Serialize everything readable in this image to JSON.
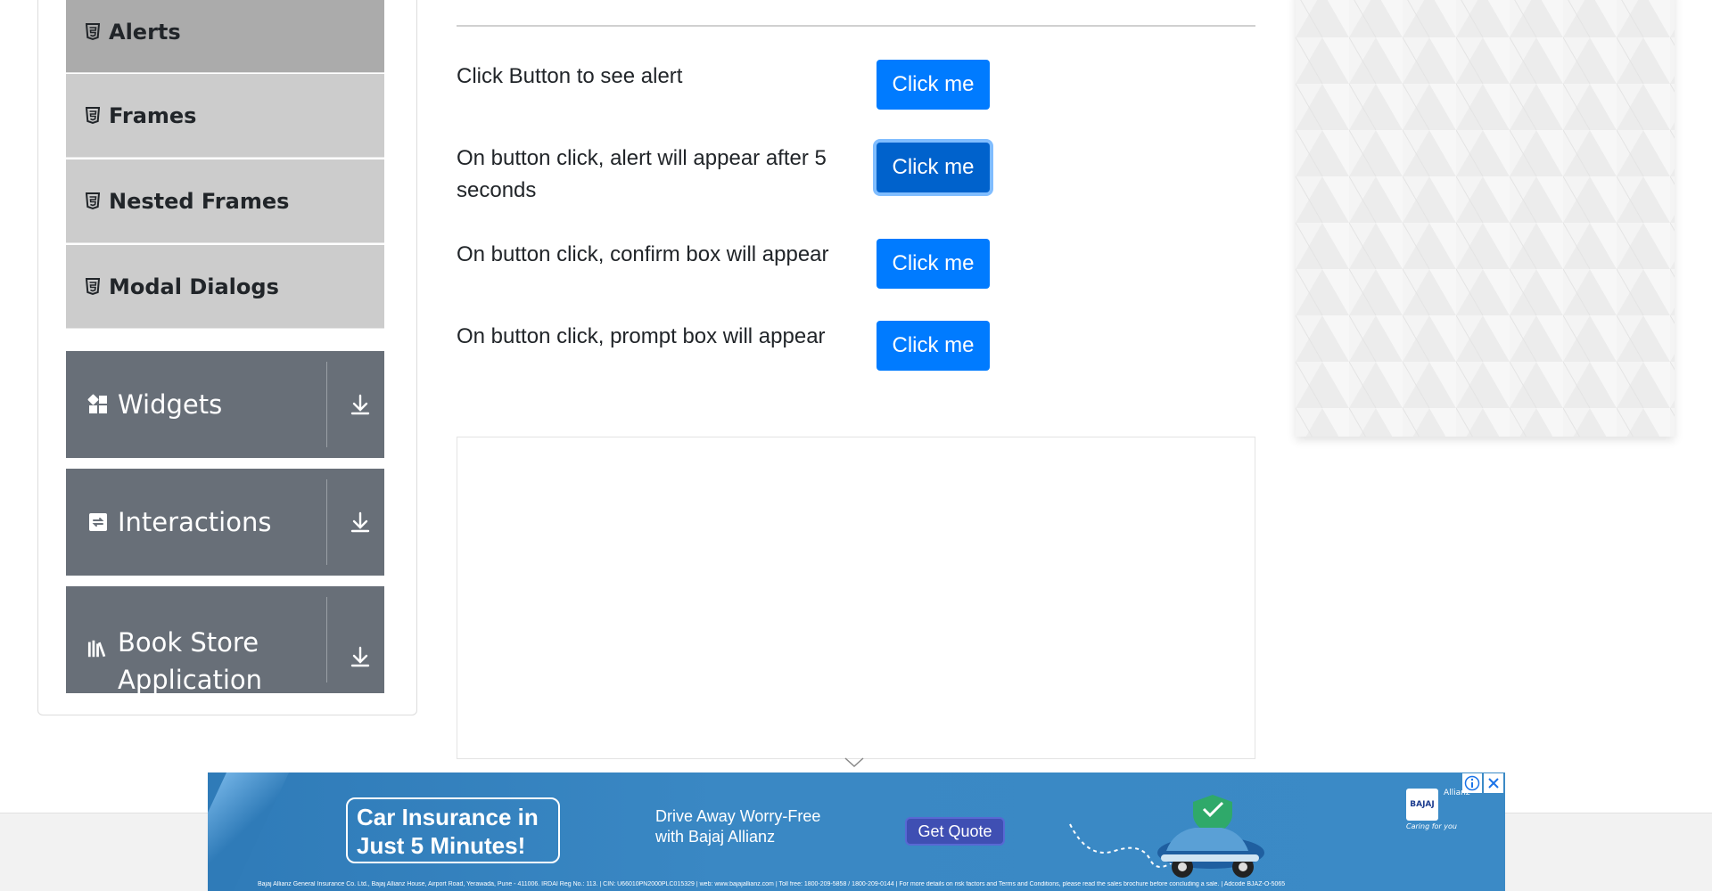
{
  "sidebar": {
    "sub_items": [
      {
        "label": "Alerts",
        "icon": "html5-icon",
        "active": true
      },
      {
        "label": "Frames",
        "icon": "html5-icon"
      },
      {
        "label": "Nested Frames",
        "icon": "html5-icon"
      },
      {
        "label": "Modal Dialogs",
        "icon": "html5-icon"
      }
    ],
    "groups": [
      {
        "label": "Widgets",
        "icon": "grid-icon"
      },
      {
        "label": "Interactions",
        "icon": "swap-icon"
      },
      {
        "label": "Book Store Application",
        "icon": "books-icon"
      }
    ]
  },
  "alerts": [
    {
      "text": "Click Button to see alert",
      "button": "Click me"
    },
    {
      "text": "On button click, alert will appear after 5 seconds",
      "button": "Click me",
      "focused": true
    },
    {
      "text": "On button click, confirm box will appear",
      "button": "Click me"
    },
    {
      "text": "On button click, prompt box will appear",
      "button": "Click me"
    }
  ],
  "banner_ad": {
    "headline": "Car Insurance in Just 5 Minutes!",
    "tagline": "Drive Away Worry-Free with Bajaj Allianz",
    "cta": "Get Quote",
    "brand_mark": "BAJAJ",
    "brand_name": "Allianz",
    "brand_slogan": "Caring for you",
    "fineprint": "Bajaj Allianz General Insurance Co. Ltd., Bajaj Allianz House, Airport Road, Yerawada, Pune - 411006. IRDAI Reg No.: 113. | CIN: U66010PN2000PLC015329 | web: www.bajajallianz.com | Toll free: 1800-209-5858 / 1800-209-0144 | For more details on risk factors and Terms and Conditions, please read the sales brochure before concluding a sale. | Adcode BJAZ-O-5065"
  },
  "colors": {
    "primary": "#007bff",
    "sidebar_group": "#686f78",
    "sub_item": "#cccccc",
    "sub_item_active": "#ababab"
  }
}
